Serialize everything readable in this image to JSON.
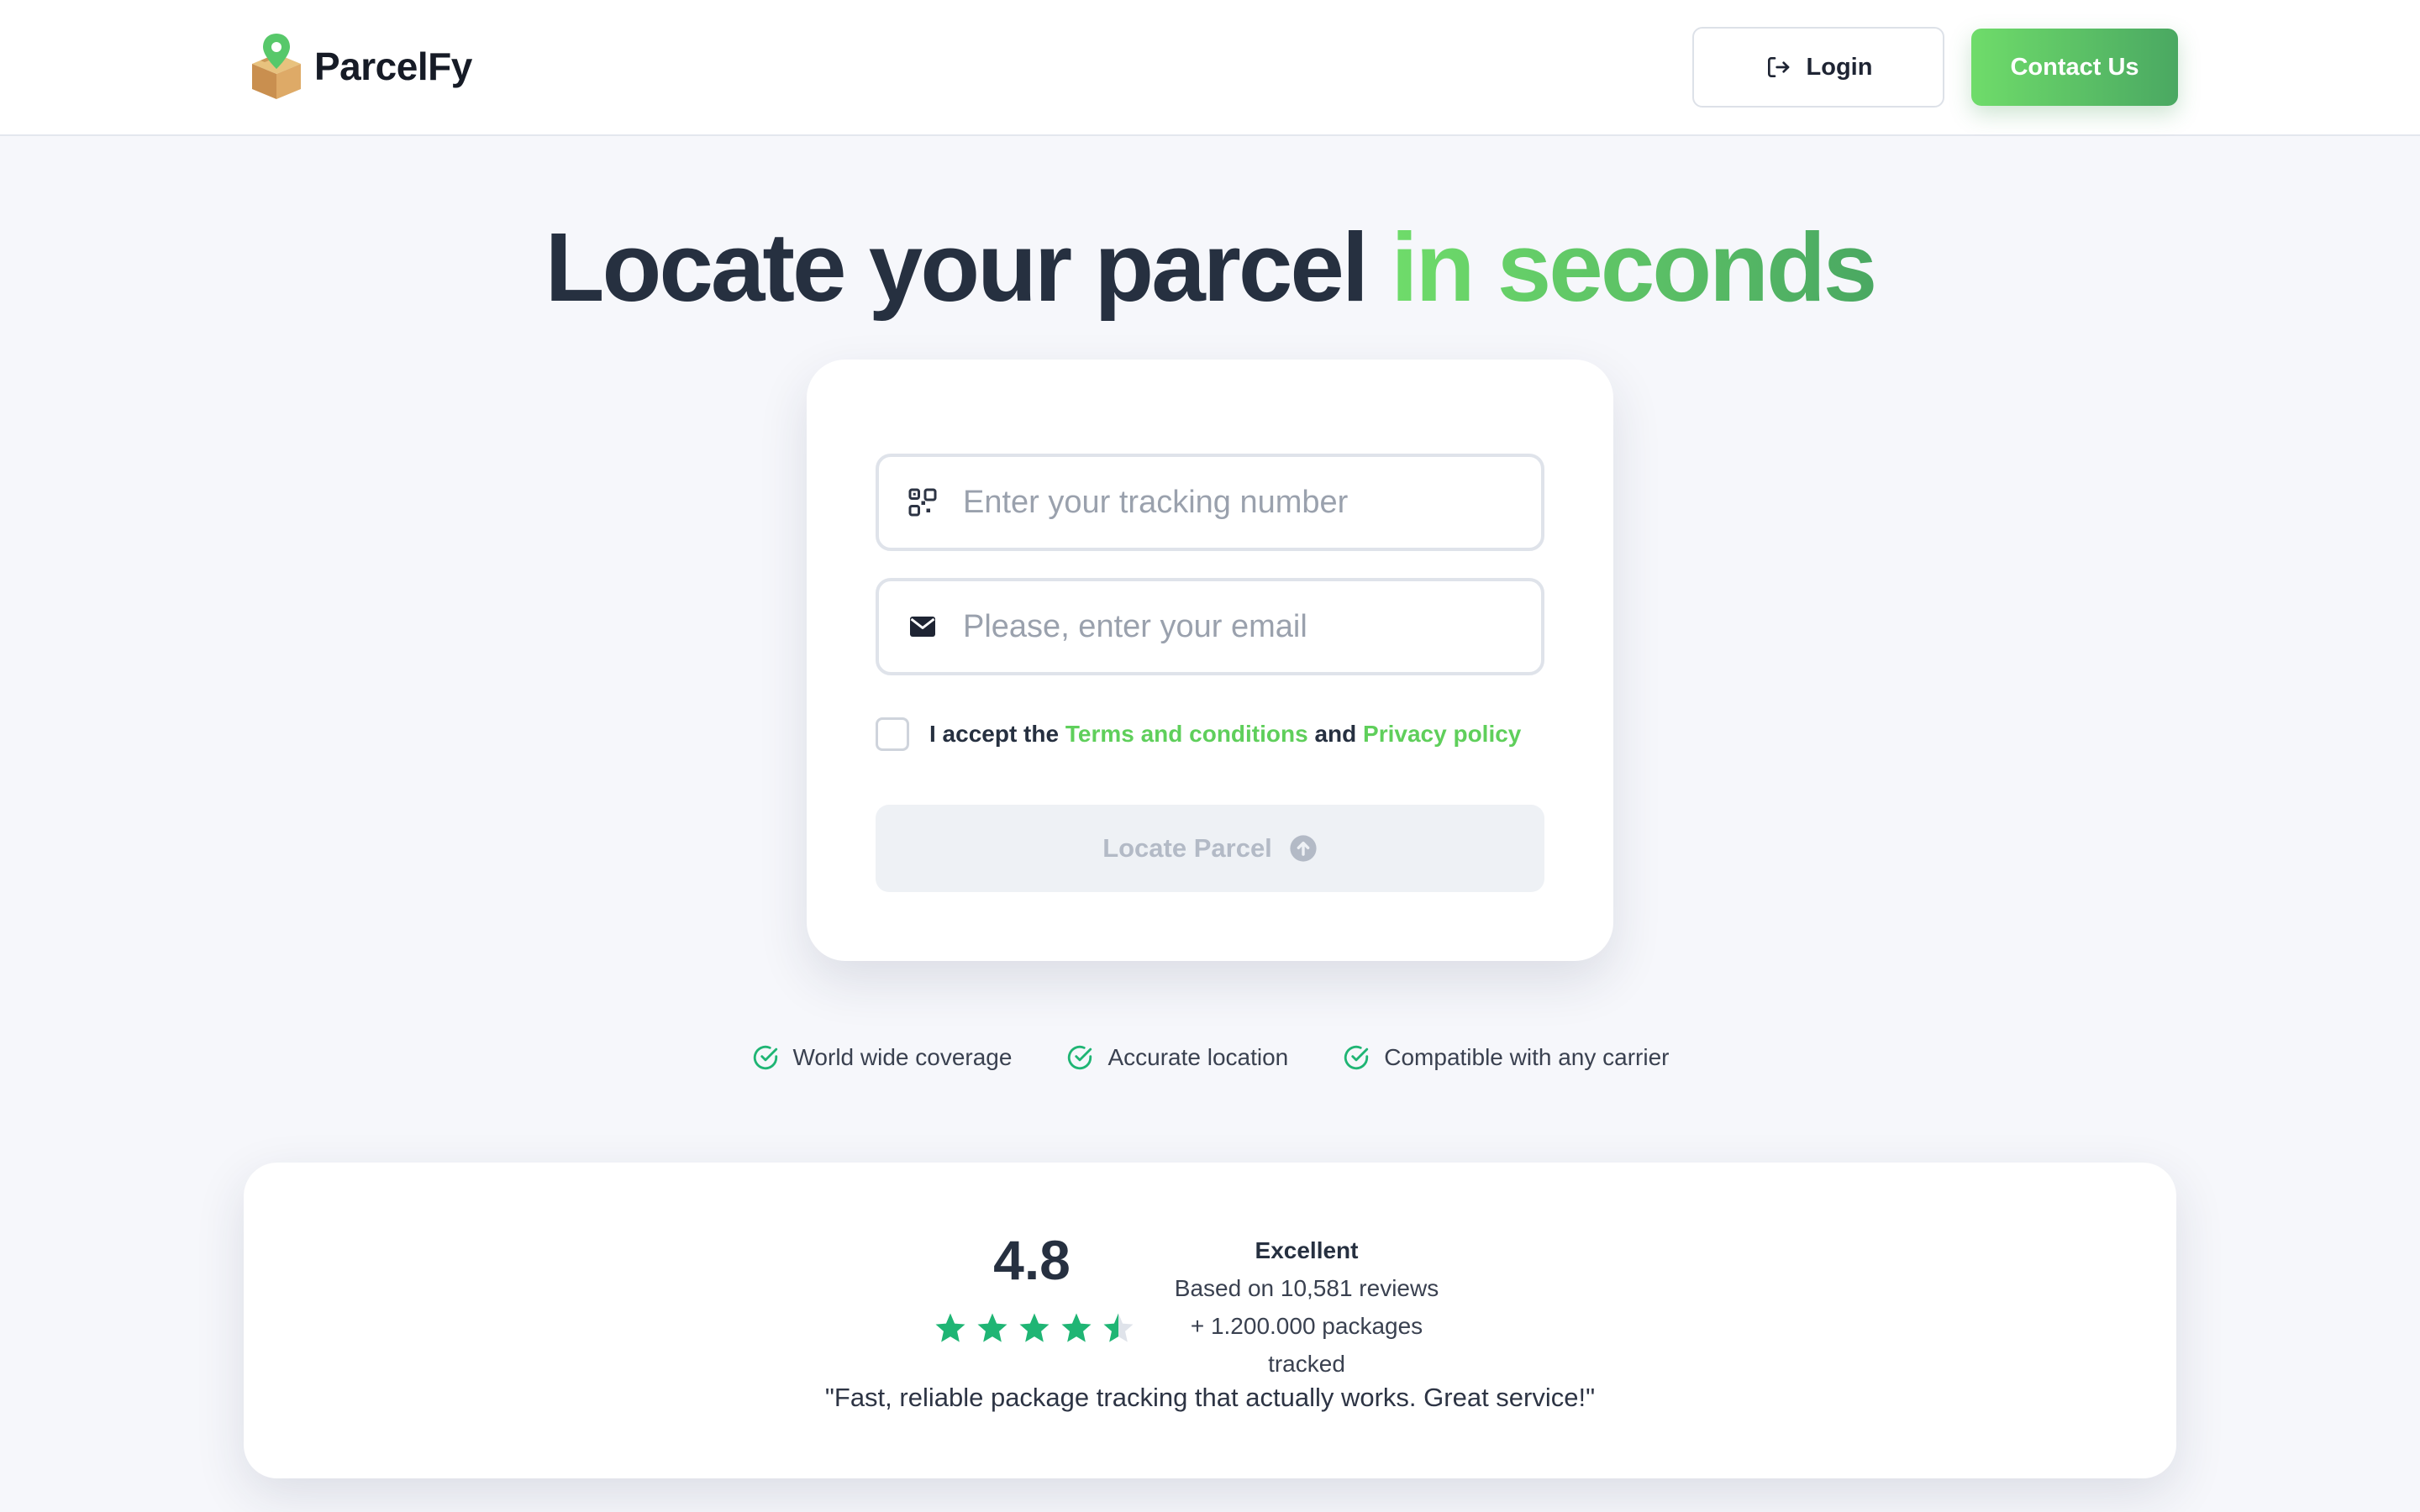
{
  "header": {
    "brand_name": "ParcelFy",
    "login_label": "Login",
    "contact_label": "Contact Us"
  },
  "hero": {
    "headline_main": "Locate your parcel ",
    "headline_accent": "in seconds"
  },
  "form": {
    "tracking_placeholder": "Enter your tracking number",
    "tracking_value": "",
    "email_placeholder": "Please, enter your email",
    "email_value": "",
    "consent_prefix": "I accept the ",
    "terms_link": "Terms and conditions",
    "consent_and": " and ",
    "privacy_link": "Privacy policy",
    "consent_checked": false,
    "submit_label": "Locate Parcel",
    "submit_enabled": false
  },
  "features": [
    {
      "label": "World wide coverage",
      "icon": "check-circle-icon"
    },
    {
      "label": "Accurate location",
      "icon": "check-circle-icon"
    },
    {
      "label": "Compatible with any carrier",
      "icon": "check-circle-icon"
    }
  ],
  "reviews": {
    "rating": "4.8",
    "stars": 4.5,
    "verdict": "Excellent",
    "based_on": "Based on 10,581 reviews",
    "packages": "+ 1.200.000 packages tracked",
    "quote": "\"Fast, reliable package tracking that actually works. Great service!\""
  },
  "colors": {
    "accent_start": "#6fdc6a",
    "accent_end": "#4aa862",
    "star": "#1fb574",
    "text_dark": "#263040"
  }
}
